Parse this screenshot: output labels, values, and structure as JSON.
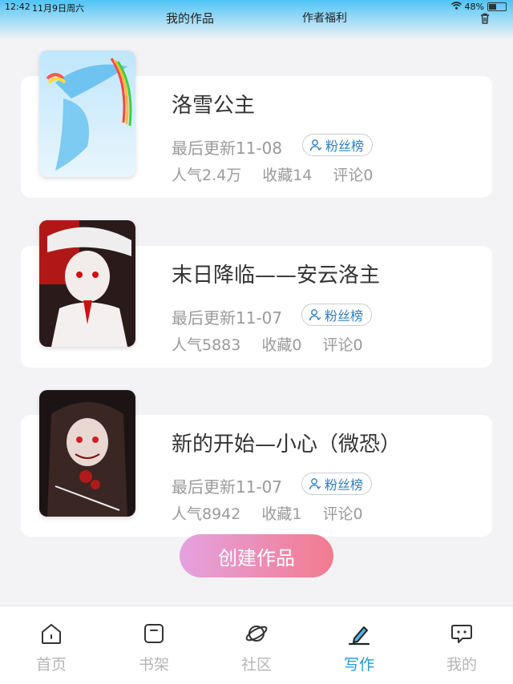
{
  "status_bar": {
    "time": "12:42",
    "date": "11月9日周六",
    "battery": "48%"
  },
  "header": {
    "tab_works": "我的作品",
    "tab_benefits": "作者福利",
    "trash_icon": "trash-icon"
  },
  "works": [
    {
      "title": "洛雪公主",
      "updated": "最后更新11-08",
      "fans_label": "粉丝榜",
      "popularity": "人气2.4万",
      "favorites": "收藏14",
      "comments": "评论0"
    },
    {
      "title": "末日降临——安云洛主",
      "updated": "最后更新11-07",
      "fans_label": "粉丝榜",
      "popularity": "人气5883",
      "favorites": "收藏0",
      "comments": "评论0"
    },
    {
      "title": "新的开始—小心（微恐）",
      "updated": "最后更新11-07",
      "fans_label": "粉丝榜",
      "popularity": "人气8942",
      "favorites": "收藏1",
      "comments": "评论0"
    }
  ],
  "create_button": "创建作品",
  "tabbar": [
    {
      "label": "首页",
      "icon": "home-icon"
    },
    {
      "label": "书架",
      "icon": "bookshelf-icon"
    },
    {
      "label": "社区",
      "icon": "planet-icon"
    },
    {
      "label": "写作",
      "icon": "pen-icon"
    },
    {
      "label": "我的",
      "icon": "chat-bubble-icon"
    }
  ],
  "colors": {
    "accent": "#1e9be0",
    "fans": "#2f7fc1",
    "create_start": "#e4a2e0",
    "create_end": "#f27b8f"
  }
}
